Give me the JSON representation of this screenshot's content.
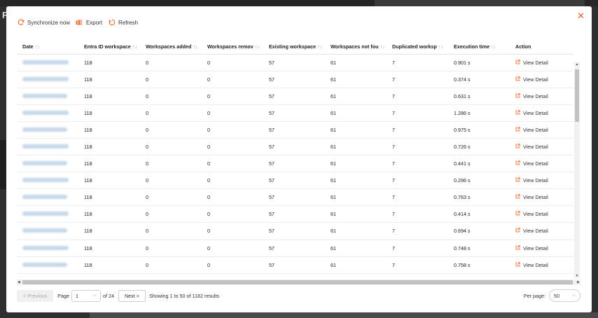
{
  "background": {
    "letter": "F"
  },
  "toolbar": {
    "sync_label": "Synchronize now",
    "export_label": "Export",
    "refresh_label": "Refresh",
    "accent_color": "#f25c1f"
  },
  "table": {
    "sort_glyph": "↑↓",
    "columns": [
      {
        "label": "Date",
        "sortable": true
      },
      {
        "label": "Entra ID workspace",
        "sortable": true
      },
      {
        "label": "Workspaces added",
        "sortable": true
      },
      {
        "label": "Workspaces remov",
        "sortable": true
      },
      {
        "label": "Existing workspace",
        "sortable": true
      },
      {
        "label": "Workspaces not fou",
        "sortable": true
      },
      {
        "label": "Duplicated worksp",
        "sortable": true
      },
      {
        "label": "Execution time",
        "sortable": true
      },
      {
        "label": "Action",
        "sortable": false
      }
    ],
    "action_label": "View Detail",
    "rows": [
      {
        "entra": "118",
        "added": "0",
        "removed": "0",
        "existing": "57",
        "not_found": "61",
        "duplicated": "7",
        "exec": "0.901 s"
      },
      {
        "entra": "118",
        "added": "0",
        "removed": "0",
        "existing": "57",
        "not_found": "61",
        "duplicated": "7",
        "exec": "0.374 s"
      },
      {
        "entra": "118",
        "added": "0",
        "removed": "0",
        "existing": "57",
        "not_found": "61",
        "duplicated": "7",
        "exec": "0.631 s"
      },
      {
        "entra": "118",
        "added": "0",
        "removed": "0",
        "existing": "57",
        "not_found": "61",
        "duplicated": "7",
        "exec": "1.286 s"
      },
      {
        "entra": "118",
        "added": "0",
        "removed": "0",
        "existing": "57",
        "not_found": "61",
        "duplicated": "7",
        "exec": "0.975 s"
      },
      {
        "entra": "118",
        "added": "0",
        "removed": "0",
        "existing": "57",
        "not_found": "61",
        "duplicated": "7",
        "exec": "0.726 s"
      },
      {
        "entra": "118",
        "added": "0",
        "removed": "0",
        "existing": "57",
        "not_found": "61",
        "duplicated": "7",
        "exec": "0.441 s"
      },
      {
        "entra": "118",
        "added": "0",
        "removed": "0",
        "existing": "57",
        "not_found": "61",
        "duplicated": "7",
        "exec": "0.296 s"
      },
      {
        "entra": "118",
        "added": "0",
        "removed": "0",
        "existing": "57",
        "not_found": "61",
        "duplicated": "7",
        "exec": "0.763 s"
      },
      {
        "entra": "118",
        "added": "0",
        "removed": "0",
        "existing": "57",
        "not_found": "61",
        "duplicated": "7",
        "exec": "0.414 s"
      },
      {
        "entra": "118",
        "added": "0",
        "removed": "0",
        "existing": "57",
        "not_found": "61",
        "duplicated": "7",
        "exec": "0.694 s"
      },
      {
        "entra": "118",
        "added": "0",
        "removed": "0",
        "existing": "57",
        "not_found": "61",
        "duplicated": "7",
        "exec": "0.748 s"
      },
      {
        "entra": "118",
        "added": "0",
        "removed": "0",
        "existing": "57",
        "not_found": "61",
        "duplicated": "7",
        "exec": "0.758 s"
      }
    ]
  },
  "pagination": {
    "previous_label": "< Previous",
    "page_label": "Page",
    "current_page": "1",
    "of_label": "of 24",
    "next_label": "Next >",
    "summary": "Showing 1 to 50 of 1182 results",
    "per_page_label": "Per page:",
    "per_page_value": "50"
  }
}
